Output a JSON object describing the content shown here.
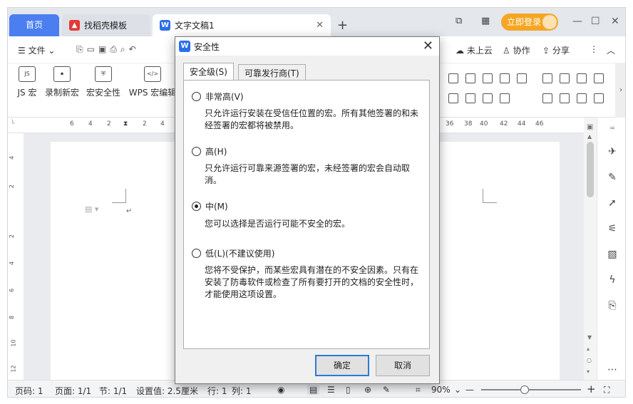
{
  "tabs": {
    "home": "首页",
    "tab1": "找稻壳模板",
    "tab2": "文字文稿1"
  },
  "login": "立即登录",
  "menu": {
    "file": "文件",
    "cloud": "未上云",
    "collab": "协作",
    "share": "分享"
  },
  "ribbon": {
    "js_macro": "JS 宏",
    "record_macro": "录制新宏",
    "macro_security": "宏安全性",
    "wps_macro_editor": "WPS 宏编辑"
  },
  "ruler": {
    "left": [
      "6",
      "4",
      "2",
      "2",
      "4"
    ],
    "right": [
      "36",
      "38",
      "40",
      "42",
      "44",
      "46"
    ],
    "vertical": [
      "4",
      "2",
      "2",
      "4",
      "6",
      "8",
      "10",
      "12"
    ]
  },
  "dialog": {
    "title": "安全性",
    "tab_security": "安全级(S)",
    "tab_publishers": "可靠发行商(T)",
    "options": [
      {
        "label": "非常高(V)",
        "desc": "只允许运行安装在受信任位置的宏。所有其他签署的和未经签署的宏都将被禁用。",
        "selected": false
      },
      {
        "label": "高(H)",
        "desc": "只允许运行可靠来源签署的宏，未经签署的宏会自动取消。",
        "selected": false
      },
      {
        "label": "中(M)",
        "desc": "您可以选择是否运行可能不安全的宏。",
        "selected": true
      },
      {
        "label": "低(L)(不建议使用)",
        "desc": "您将不受保护，而某些宏具有潜在的不安全因素。只有在安装了防毒软件或检查了所有要打开的文档的安全性时，才能使用这项设置。",
        "selected": false
      }
    ],
    "ok": "确定",
    "cancel": "取消"
  },
  "status": {
    "page_num": "页码: 1",
    "pages": "页面: 1/1",
    "section": "节: 1/1",
    "setting": "设置值: 2.5厘米",
    "row": "行: 1",
    "col": "列: 1",
    "zoom": "90%"
  },
  "colors": {
    "accent": "#4b7ff0",
    "login": "#f5a623"
  }
}
